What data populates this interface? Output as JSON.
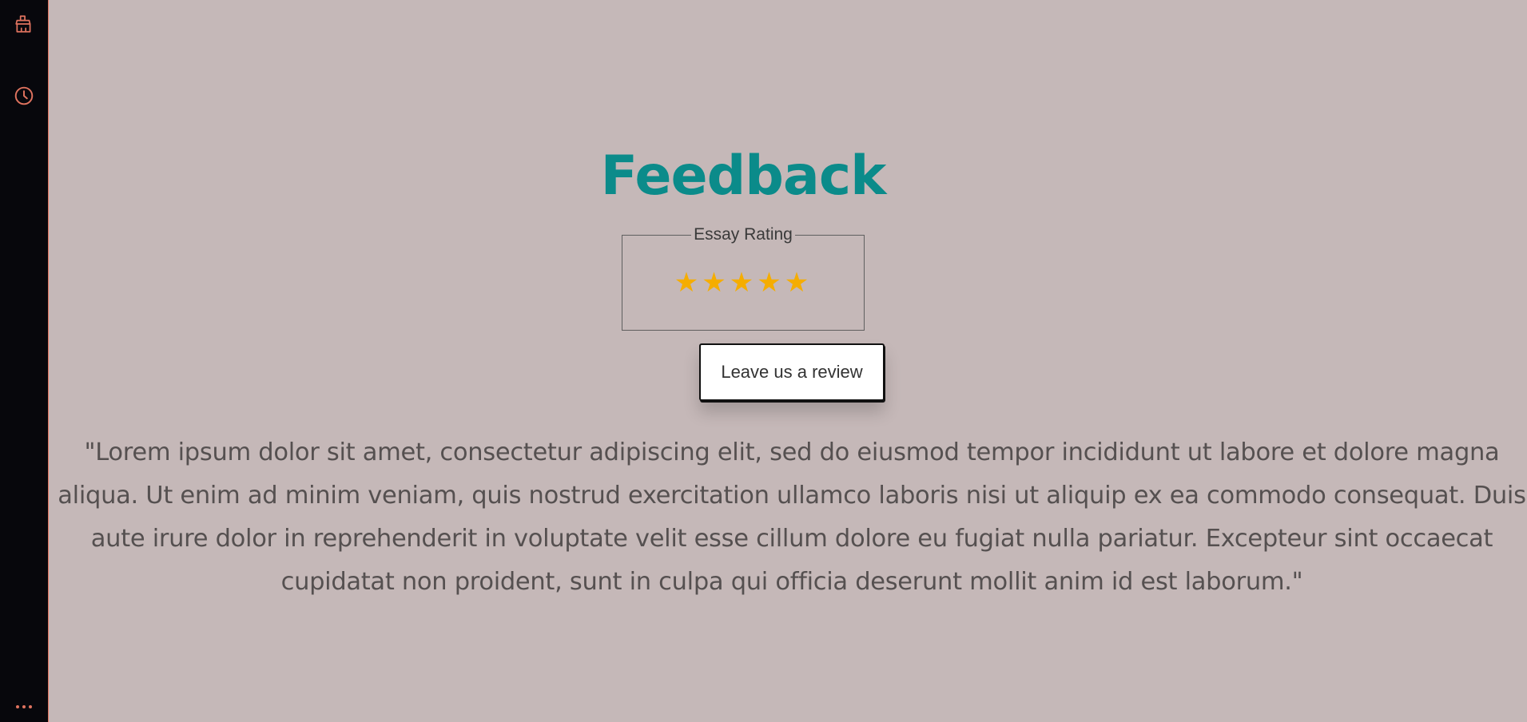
{
  "sidebar": {
    "icons": [
      {
        "name": "brush-icon"
      },
      {
        "name": "clock-icon"
      },
      {
        "name": "more-icon"
      }
    ],
    "accent_color": "#e0735f"
  },
  "main": {
    "title": "Feedback",
    "rating": {
      "legend": "Essay Rating",
      "stars": [
        "★",
        "★",
        "★",
        "★",
        "★"
      ],
      "value": 5,
      "max": 5,
      "star_color": "#f5ad00"
    },
    "review_button_label": "Leave us a review",
    "quote": "\"Lorem ipsum dolor sit amet, consectetur adipiscing elit, sed do eiusmod tempor incididunt ut labore et dolore magna aliqua. Ut enim ad minim veniam, quis nostrud exercitation ullamco laboris nisi ut aliquip ex ea commodo consequat. Duis aute irure dolor in reprehenderit in voluptate velit esse cillum dolore eu fugiat nulla pariatur. Excepteur sint occaecat cupidatat non proident, sunt in culpa qui officia deserunt mollit anim id est laborum.\""
  },
  "colors": {
    "background": "#c5b8b8",
    "sidebar_background": "#07070c",
    "title": "#0b8b8a"
  }
}
